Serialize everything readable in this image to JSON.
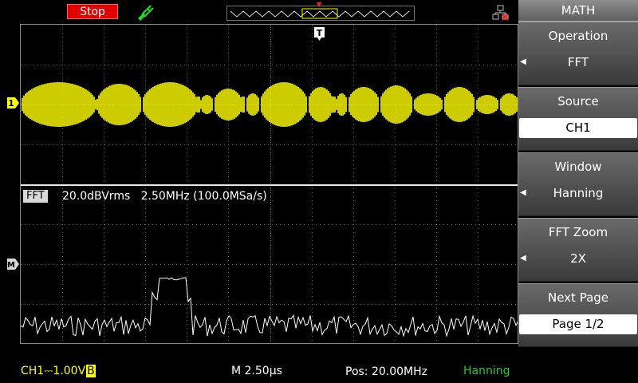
{
  "status": {
    "run_state": "Stop"
  },
  "screen": {
    "fft_label": "FFT",
    "fft_info": "20.0dBVrms   2.50MHz (100.0MSa/s)",
    "trigger_marker": "T",
    "ch1_marker": "1",
    "math_marker": "M"
  },
  "menu": {
    "title": "MATH",
    "items": [
      {
        "label": "Operation",
        "value": "FFT",
        "selected": false
      },
      {
        "label": "Source",
        "value": "CH1",
        "selected": true
      },
      {
        "label": "Window",
        "value": "Hanning",
        "selected": false
      },
      {
        "label": "FFT Zoom",
        "value": "2X",
        "selected": false
      },
      {
        "label": "Next Page",
        "value": "Page 1/2",
        "selected": true
      }
    ]
  },
  "bottom": {
    "ch1_label": "CH1",
    "ch1_coupling": "⎓",
    "ch1_volts": "1.00V",
    "ch1_bw": "B",
    "timebase": "M 2.50μs",
    "position": "Pos: 20.00MHz",
    "window": "Hanning"
  },
  "colors": {
    "ch1": "#ffff00",
    "math": "#ffffff",
    "stop": "#e00000",
    "window_status": "#22cc22"
  },
  "icons": [
    "probe-icon",
    "network-icon",
    "trigger-icon"
  ]
}
